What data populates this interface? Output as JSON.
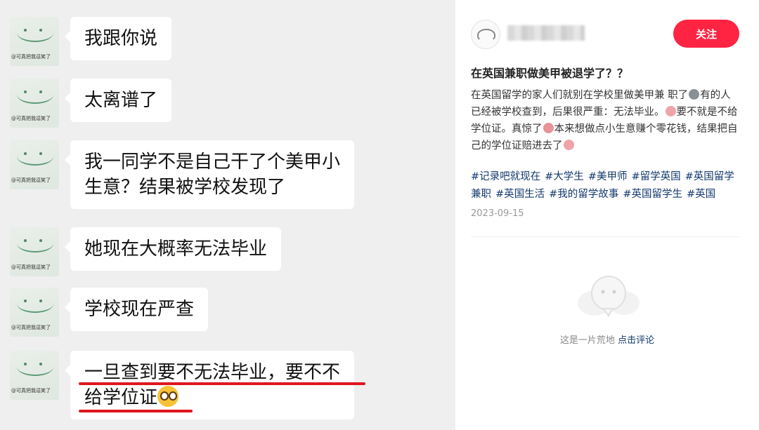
{
  "chat": {
    "avatar_caption": "@可真把我逗笑了",
    "messages": [
      {
        "text": "我跟你说"
      },
      {
        "text": "太离谱了"
      },
      {
        "line1": "我一同学不是自己干了个美甲小",
        "line2": "生意？结果被学校发现了"
      },
      {
        "text": "她现在大概率无法毕业"
      },
      {
        "text": "学校现在严查"
      },
      {
        "line1": "一旦查到要不无法毕业，要不不",
        "line2": "给学位证",
        "emoji": "flushed-face-icon"
      }
    ],
    "highlight_color": "#e0161e"
  },
  "post": {
    "follow_label": "关注",
    "title": "在英国兼职做美甲被退学了？？",
    "body": {
      "p1": "在英国留学的家人们就别在学校里做美甲兼 职了",
      "p2": "有的人已经被学校查到，后果很严重：无法毕业。",
      "p3": "要不就是不给学位证。真惊了",
      "p4": "本来想做点小生意赚个零花钱，结果把自己的学位证赔进去了"
    },
    "tags": [
      "#记录吧就现在",
      "#大学生",
      "#美甲师",
      "#留学英国",
      "#英国留学兼职",
      "#英国生活",
      "#我的留学故事",
      "#英国留学生",
      "#英国"
    ],
    "date": "2023-09-15",
    "empty_text": "这是一片荒地",
    "comment_link": "点击评论",
    "accent_color": "#ff2442",
    "tag_color": "#13386c"
  }
}
